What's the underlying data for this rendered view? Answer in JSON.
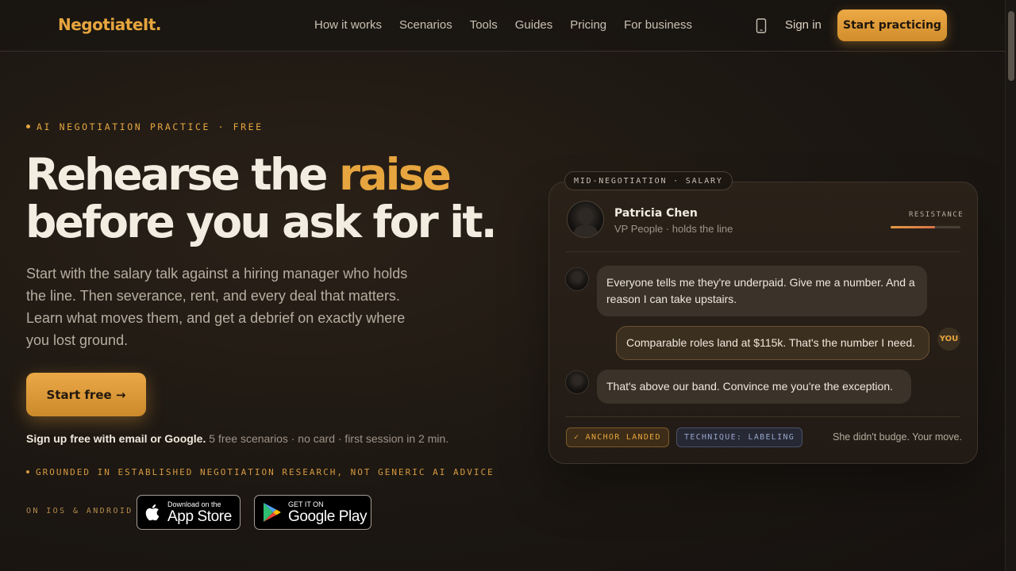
{
  "nav": {
    "logo": "NegotiateIt.",
    "links": [
      "How it works",
      "Scenarios",
      "Tools",
      "Guides",
      "Pricing",
      "For business"
    ],
    "signin": "Sign in",
    "cta": "Start practicing"
  },
  "hero": {
    "eyebrow": "AI NEGOTIATION PRACTICE · FREE",
    "headline_part1": "Rehearse the ",
    "headline_accent": "raise",
    "headline_part2": "before you ask for it.",
    "subcopy": "Start with the salary talk against a hiring manager who holds the line. Then severance, rent, and every deal that matters. Learn what moves them, and get a debrief on exactly where you lost ground.",
    "cta": "Start free →",
    "signup_bold": "Sign up free with email or Google.",
    "signup_rest": " 5 free scenarios · no card · first session in 2 min.",
    "grounded": "GROUNDED IN ESTABLISHED NEGOTIATION RESEARCH, NOT GENERIC AI ADVICE",
    "platforms": "ON IOS & ANDROID",
    "appstore_small": "Download on the",
    "appstore_big": "App Store",
    "googleplay_small": "GET IT ON",
    "googleplay_big": "Google Play"
  },
  "card": {
    "tag": "MID-NEGOTIATION · SALARY",
    "name": "Patricia Chen",
    "role": "VP People · holds the line",
    "resistance_label": "RESISTANCE",
    "resistance_level": 0.64,
    "messages": [
      {
        "from": "them",
        "text": "Everyone tells me they're underpaid. Give me a number. And a reason I can take upstairs."
      },
      {
        "from": "me",
        "text": "Comparable roles land at $115k. That's the number I need."
      },
      {
        "from": "them",
        "text": "That's above our band. Convince me you're the exception."
      }
    ],
    "you_badge": "YOU",
    "chip_anchor": "✓ ANCHOR LANDED",
    "chip_technique": "TECHNIQUE: LABELING",
    "footer_note": "She didn't budge. Your move."
  },
  "colors": {
    "accent": "#e6a53e",
    "background": "#1c1712",
    "technique_chip": "#97a3c9"
  }
}
